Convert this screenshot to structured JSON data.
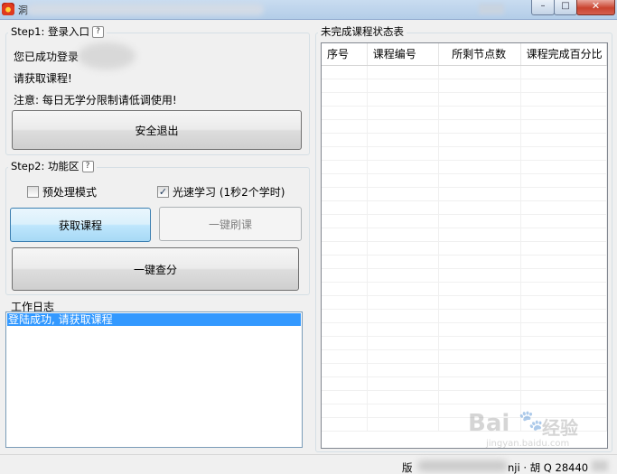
{
  "window": {
    "title_fragment": "洞",
    "controls": {
      "minimize": "–",
      "maximize": "□",
      "close": "✕"
    }
  },
  "step1": {
    "legend": "Step1: 登录入口",
    "help": "?",
    "status_text": "您已成功登录",
    "prompt": "请获取课程!",
    "notice": "注意: 每日无学分限制请低调使用!",
    "logout_button": "安全退出"
  },
  "step2": {
    "legend": "Step2: 功能区",
    "help": "?",
    "preprocess_label": "预处理模式",
    "preprocess_checked": false,
    "fast_label": "光速学习 (1秒2个学时)",
    "fast_checked": true,
    "get_courses_button": "获取课程",
    "brush_button": "一键刷课",
    "query_button": "一键查分"
  },
  "log": {
    "legend": "工作日志",
    "lines": [
      "登陆成功, 请获取课程"
    ]
  },
  "table": {
    "legend": "未完成课程状态表",
    "columns": [
      "序号",
      "课程编号",
      "所剩节点数",
      "课程完成百分比"
    ],
    "rows": []
  },
  "statusbar": {
    "prefix": "版",
    "suffix": "nji · 胡 Q 28440"
  },
  "watermark": {
    "brand": "Bai",
    "brand_cn": "经验",
    "url": "jingyan.baidu.com"
  },
  "colors": {
    "selection": "#3399ff",
    "focus_border": "#3c7fb1",
    "close_button": "#c9432f"
  }
}
